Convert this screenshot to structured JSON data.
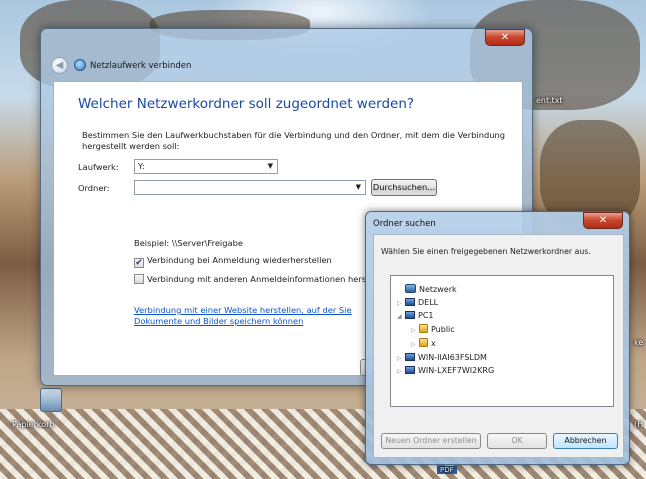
{
  "desktop": {
    "left_icon_label": "Papierkorb",
    "right_icon_label": "ent.txt",
    "right_edge_label_1": "ke",
    "right_edge_label_2": "(H",
    "bottom_taskbar_label": "PDF"
  },
  "wizard": {
    "title": "Netzlaufwerk verbinden",
    "heading": "Welcher Netzwerkordner soll zugeordnet werden?",
    "intro": "Bestimmen Sie den Laufwerkbuchstaben für die Verbindung und den Ordner, mit dem die Verbindung hergestellt werden soll:",
    "drive_label": "Laufwerk:",
    "drive_value": "Y:",
    "folder_label": "Ordner:",
    "folder_value": "",
    "browse_button": "Durchsuchen...",
    "example": "Beispiel: \\\\Server\\Freigabe",
    "reconnect_label": "Verbindung bei Anmeldung wiederherstellen",
    "reconnect_checked": true,
    "other_creds_label": "Verbindung mit anderen Anmeldeinformationen herstellen",
    "other_creds_checked": false,
    "website_link": "Verbindung mit einer Website herstellen, auf der Sie Dokumente und Bilder speichern können",
    "close_glyph": "✕"
  },
  "browse_dialog": {
    "title": "Ordner suchen",
    "instruction": "Wählen Sie einen freigegebenen Netzwerkordner aus.",
    "tree": [
      {
        "label": "Netzwerk",
        "icon": "network-icon",
        "level": 0,
        "expander": ""
      },
      {
        "label": "DELL",
        "icon": "computer-icon",
        "level": 1,
        "expander": "▷"
      },
      {
        "label": "PC1",
        "icon": "computer-icon",
        "level": 1,
        "expander": "◢"
      },
      {
        "label": "Public",
        "icon": "shared-folder-icon",
        "level": 2,
        "expander": "▷"
      },
      {
        "label": "x",
        "icon": "shared-folder-icon",
        "level": 2,
        "expander": "▷"
      },
      {
        "label": "WIN-IIAI63FSLDM",
        "icon": "computer-icon",
        "level": 1,
        "expander": "▷"
      },
      {
        "label": "WIN-LXEF7WI2KRG",
        "icon": "computer-icon",
        "level": 1,
        "expander": "▷"
      }
    ],
    "new_folder_button": "Neuen Ordner erstellen",
    "ok_button": "OK",
    "cancel_button": "Abbrechen",
    "close_glyph": "✕"
  },
  "colors": {
    "heading_blue": "#1b4aa0",
    "link_blue": "#0b55c6",
    "close_red": "#c7442b"
  }
}
